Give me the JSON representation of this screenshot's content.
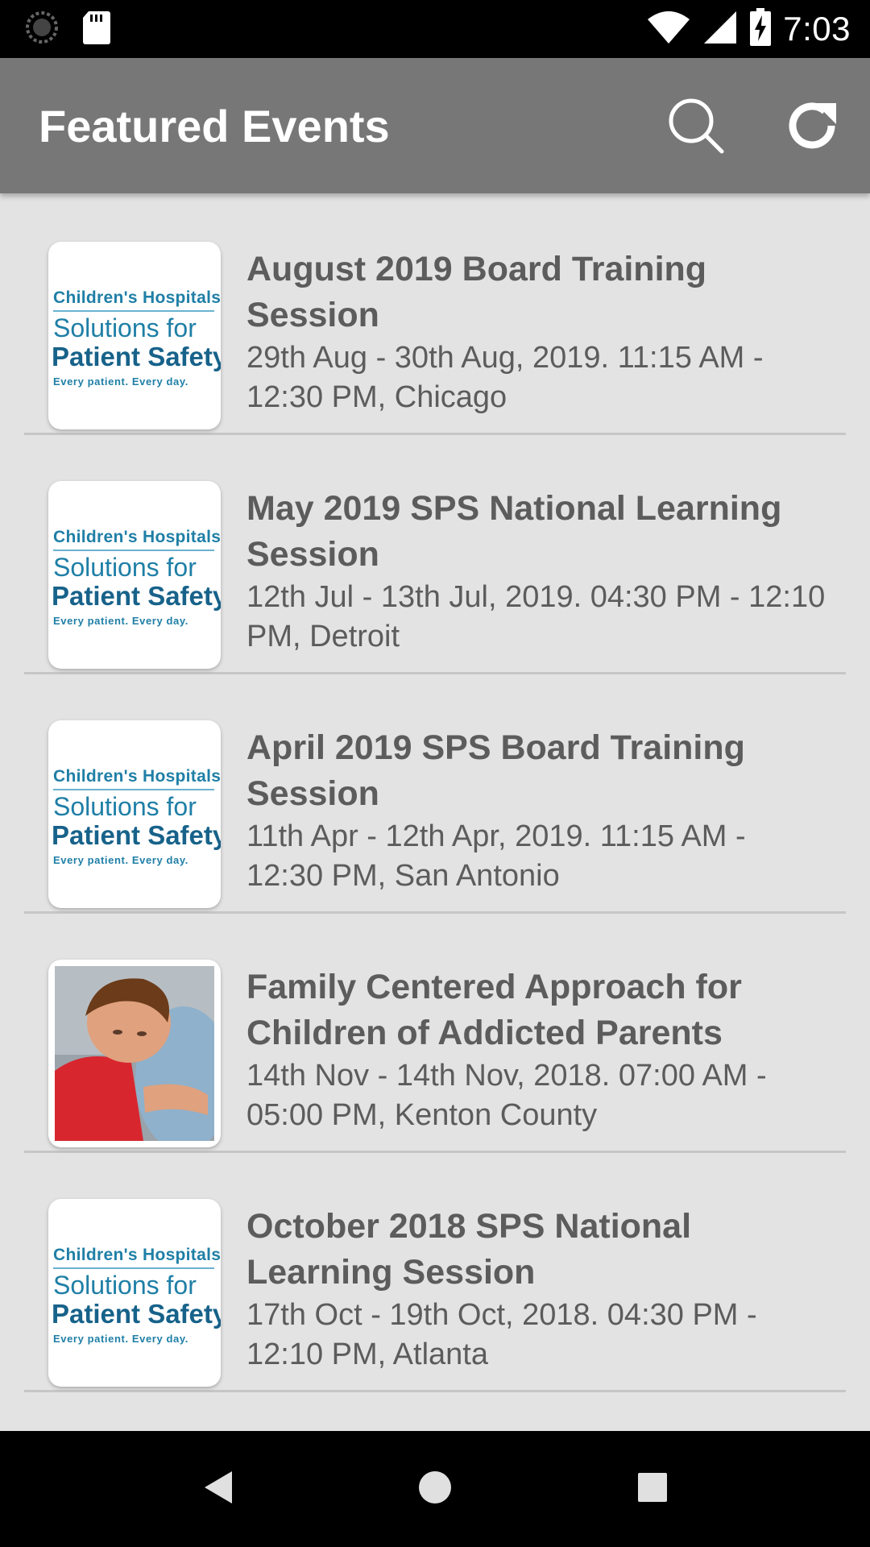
{
  "status_bar": {
    "time": "7:03",
    "icons": [
      "loading-icon",
      "sd-card-icon",
      "wifi-icon",
      "cell-signal-icon",
      "battery-charging-icon"
    ]
  },
  "app_bar": {
    "title": "Featured Events",
    "actions": [
      "search-icon",
      "refresh-icon"
    ]
  },
  "logo_text": {
    "line1": "Children's Hospitals",
    "line2": "Solutions for",
    "line3": "Patient Safety",
    "line4": "Every patient. Every day."
  },
  "events": [
    {
      "title": "August 2019 Board Training Session",
      "details": "29th Aug - 30th Aug, 2019. 11:15 AM - 12:30 PM, Chicago",
      "thumbnail": "logo"
    },
    {
      "title": "May 2019 SPS National Learning Session",
      "details": "12th Jul - 13th Jul, 2019. 04:30 PM - 12:10 PM, Detroit",
      "thumbnail": "logo"
    },
    {
      "title": "April 2019 SPS Board Training Session",
      "details": "11th Apr - 12th Apr, 2019. 11:15 AM - 12:30 PM, San Antonio",
      "thumbnail": "logo"
    },
    {
      "title": "Family Centered Approach for Children of Addicted Parents",
      "details": "14th Nov - 14th Nov, 2018. 07:00 AM - 05:00 PM, Kenton County",
      "thumbnail": "photo"
    },
    {
      "title": "October 2018 SPS National Learning Session",
      "details": "17th Oct - 19th Oct, 2018. 04:30 PM - 12:10 PM, Atlanta",
      "thumbnail": "logo"
    }
  ],
  "nav_bar": {
    "buttons": [
      "back-icon",
      "home-icon",
      "recents-icon"
    ]
  },
  "colors": {
    "app_bar": "#777777",
    "background": "#e3e3e3",
    "text": "#5c5c5c",
    "logo_blue": "#1f7fa6"
  }
}
